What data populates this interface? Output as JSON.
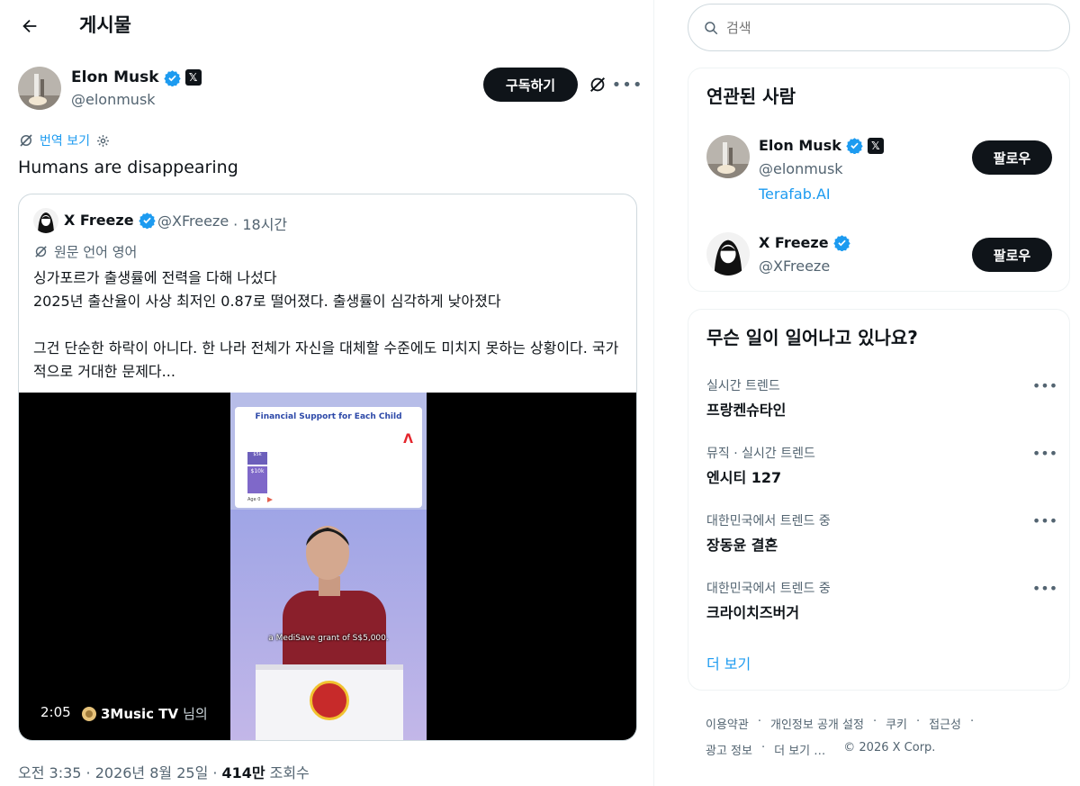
{
  "header": {
    "title": "게시물"
  },
  "post": {
    "author": {
      "name": "Elon Musk",
      "handle": "@elonmusk"
    },
    "subscribe_label": "구독하기",
    "translate_label": "번역 보기",
    "text": "Humans are disappearing",
    "timestamp": "오전 3:35 · 2026년 8월 25일 ·",
    "views": "414만",
    "views_label": "조회수"
  },
  "quote": {
    "author": {
      "name": "X Freeze",
      "handle": "@XFreeze",
      "age": "· 18시간"
    },
    "lang_label": "원문 언어 영어",
    "body": "싱가포르가 출생률에 전력을 다해 나섰다\n2025년 출산율이 사상 최저인 0.87로 떨어졌다. 출생률이 심각하게 낮아졌다\n\n그건 단순한 하락이 아니다. 한 나라 전체가 자신을 대체할 수준에도 미치지 못하는 상황이다. 국가적으로 거대한 문제다...",
    "video": {
      "slide_title": "Financial Support for Each Child",
      "bar1_label": "$5k",
      "bar2_label": "$10k",
      "age_label": "Age 0",
      "caption": "a MediSave grant of S$5,000.",
      "duration": "2:05",
      "source_name": "3Music TV",
      "source_suffix": "님의"
    }
  },
  "sidebar": {
    "search_placeholder": "검색",
    "related": {
      "title": "연관된 사람",
      "people": [
        {
          "name": "Elon Musk",
          "handle": "@elonmusk",
          "link": "Terafab.AI",
          "follow_label": "팔로우"
        },
        {
          "name": "X Freeze",
          "handle": "@XFreeze",
          "follow_label": "팔로우"
        }
      ]
    },
    "trends": {
      "title": "무슨 일이 일어나고 있나요?",
      "items": [
        {
          "category": "실시간 트렌드",
          "name": "프랑켄슈타인"
        },
        {
          "category": "뮤직 · 실시간 트렌드",
          "name": "엔시티 127"
        },
        {
          "category": "대한민국에서 트렌드 중",
          "name": "장동윤 결혼"
        },
        {
          "category": "대한민국에서 트렌드 중",
          "name": "크라이치즈버거"
        }
      ],
      "show_more": "더 보기"
    },
    "footer": {
      "terms": "이용약관",
      "privacy": "개인정보 공개 설정",
      "cookies": "쿠키",
      "accessibility": "접근성",
      "ads": "광고 정보",
      "more": "더 보기 …",
      "copyright": "© 2026 X Corp."
    }
  },
  "colors": {
    "accent": "#1d9bf0",
    "text": "#0f1419",
    "muted": "#536471",
    "border": "#cfd9de"
  },
  "icons": [
    "back-arrow-icon",
    "verified-icon",
    "x-badge-icon",
    "grok-icon",
    "more-icon",
    "translate-icon",
    "gear-icon",
    "search-icon"
  ]
}
